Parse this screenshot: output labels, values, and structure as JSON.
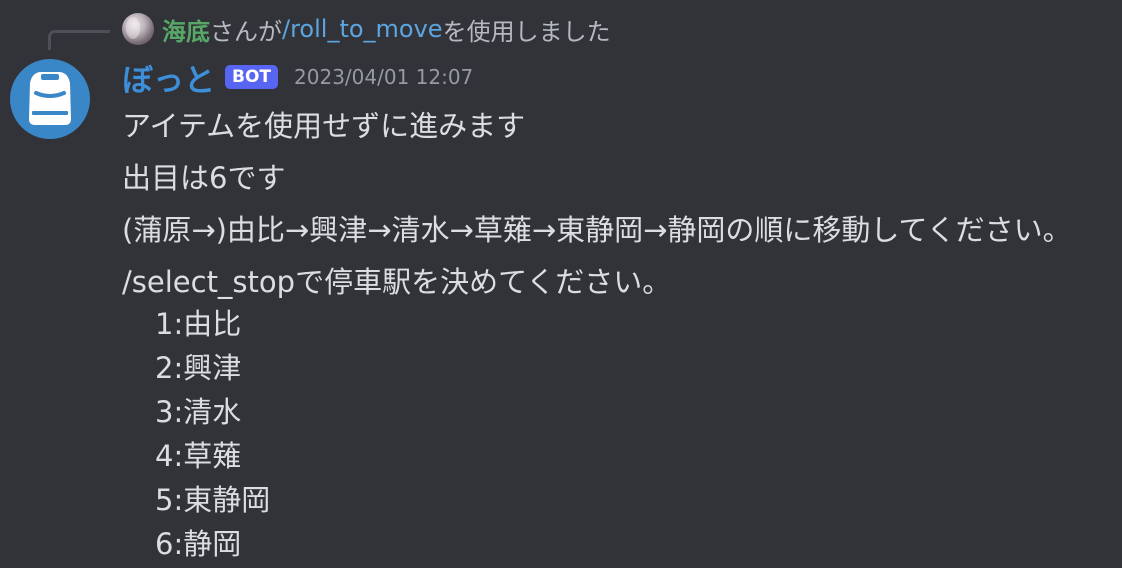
{
  "reply": {
    "username": "海底",
    "text_middle": "さんが",
    "command": "/roll_to_move",
    "text_end": "を使用しました"
  },
  "message": {
    "username": "ぼっと",
    "tag": "BOT",
    "timestamp": "2023/04/01 12:07",
    "lines": [
      "アイテムを使用せずに進みます",
      "出目は6です",
      "(蒲原→)由比→興津→清水→草薙→東静岡→静岡の順に移動してください。",
      "/select_stopで停車駅を決めてください。"
    ],
    "stops": [
      "1:由比",
      "2:興津",
      "3:清水",
      "4:草薙",
      "5:東静岡",
      "6:静岡"
    ]
  },
  "colors": {
    "background": "#313338",
    "reply_username": "#57a868",
    "command": "#5da5e0",
    "bot_username": "#3d8fd9",
    "bot_tag": "#5865f2",
    "avatar": "#3a87c8"
  },
  "icons": {
    "bot_avatar": "robot-avatar-icon",
    "reply_avatar": "user-avatar-icon"
  }
}
